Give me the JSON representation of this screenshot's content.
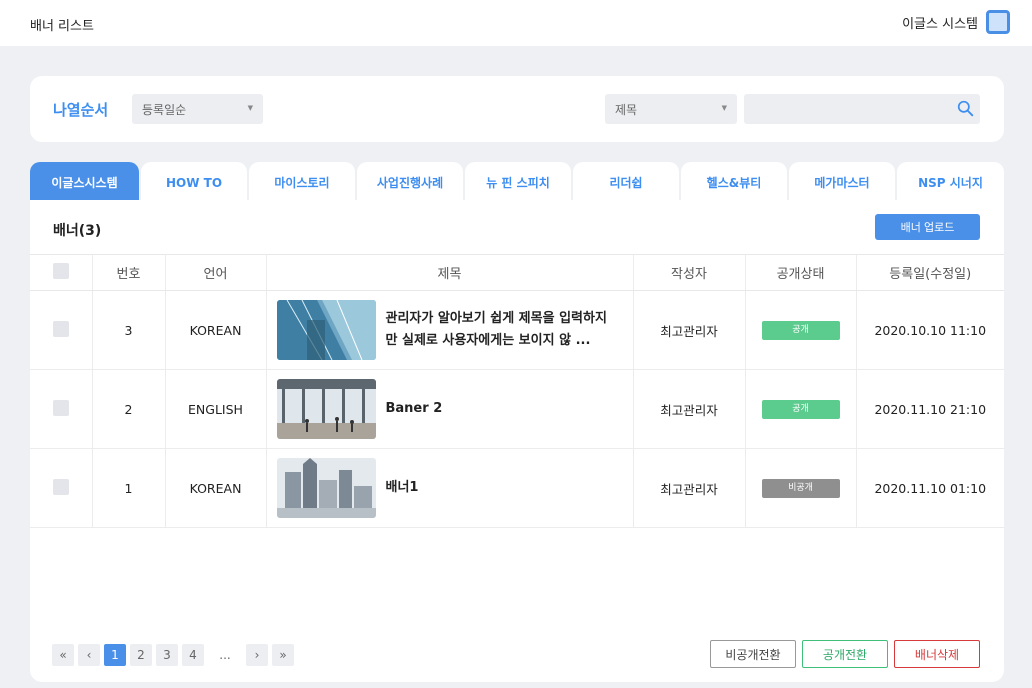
{
  "topbar": {
    "title": "배너 리스트",
    "brand": "이글스 시스템"
  },
  "filter": {
    "sort_label": "나열순서",
    "sort_value": "등록일순",
    "field_value": "제목",
    "search_value": ""
  },
  "tabs": [
    "이글스시스템",
    "HOW TO",
    "마이스토리",
    "사업진행사례",
    "뉴 핀 스피치",
    "리더쉽",
    "헬스&뷰티",
    "메가마스터",
    "NSP 시너지"
  ],
  "list": {
    "title": "배너(3)",
    "upload_label": "배너 업로드",
    "columns": [
      "번호",
      "언어",
      "제목",
      "작성자",
      "공개상태",
      "등록일(수정일)"
    ],
    "rows": [
      {
        "no": "3",
        "lang": "KOREAN",
        "title": "관리자가 알아보기 쉽게 제목을 입력하지만 실제로 사용자에게는 보이지 않 ...",
        "author": "최고관리자",
        "status": "공개",
        "date": "2020.10.10 11:10",
        "thumb": "glass-building"
      },
      {
        "no": "2",
        "lang": "ENGLISH",
        "title": "Baner 2",
        "author": "최고관리자",
        "status": "공개",
        "date": "2020.11.10 21:10",
        "thumb": "lobby"
      },
      {
        "no": "1",
        "lang": "KOREAN",
        "title": "배너1",
        "author": "최고관리자",
        "status": "비공개",
        "date": "2020.11.10 01:10",
        "thumb": "skyline"
      }
    ]
  },
  "pager": {
    "first": "«",
    "prev": "‹",
    "pages": [
      "1",
      "2",
      "3",
      "4"
    ],
    "dots": "...",
    "next": "›",
    "last": "»",
    "current": "1"
  },
  "actions": {
    "make_private": "비공개전환",
    "make_public": "공개전환",
    "delete": "배너삭제"
  },
  "colors": {
    "accent": "#4a90e8",
    "public": "#5ccb8e",
    "private": "#8f8f8f",
    "danger": "#d63a3a"
  }
}
